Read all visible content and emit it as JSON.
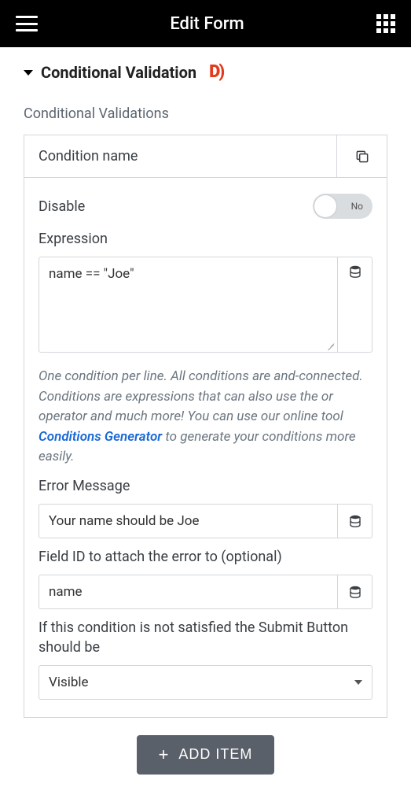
{
  "header": {
    "title": "Edit Form"
  },
  "section": {
    "title": "Conditional Validation",
    "subheading": "Conditional Validations"
  },
  "condition": {
    "name_label": "Condition name",
    "disable_label": "Disable",
    "disable_state": "No",
    "expression_label": "Expression",
    "expression_value": "name == \"Joe\"",
    "helper_pre": "One condition per line. All conditions are and-connected. Conditions are expressions that can also use the or operator and much more! You can use our online tool ",
    "helper_link": "Conditions Generator",
    "helper_post": " to generate your conditions more easily.",
    "error_label": "Error Message",
    "error_value": "Your name should be Joe",
    "fieldid_label": "Field ID to attach the error to (optional)",
    "fieldid_value": "name",
    "submit_label": "If this condition is not satisfied the Submit Button should be",
    "submit_value": "Visible"
  },
  "actions": {
    "add_item": "ADD ITEM"
  }
}
